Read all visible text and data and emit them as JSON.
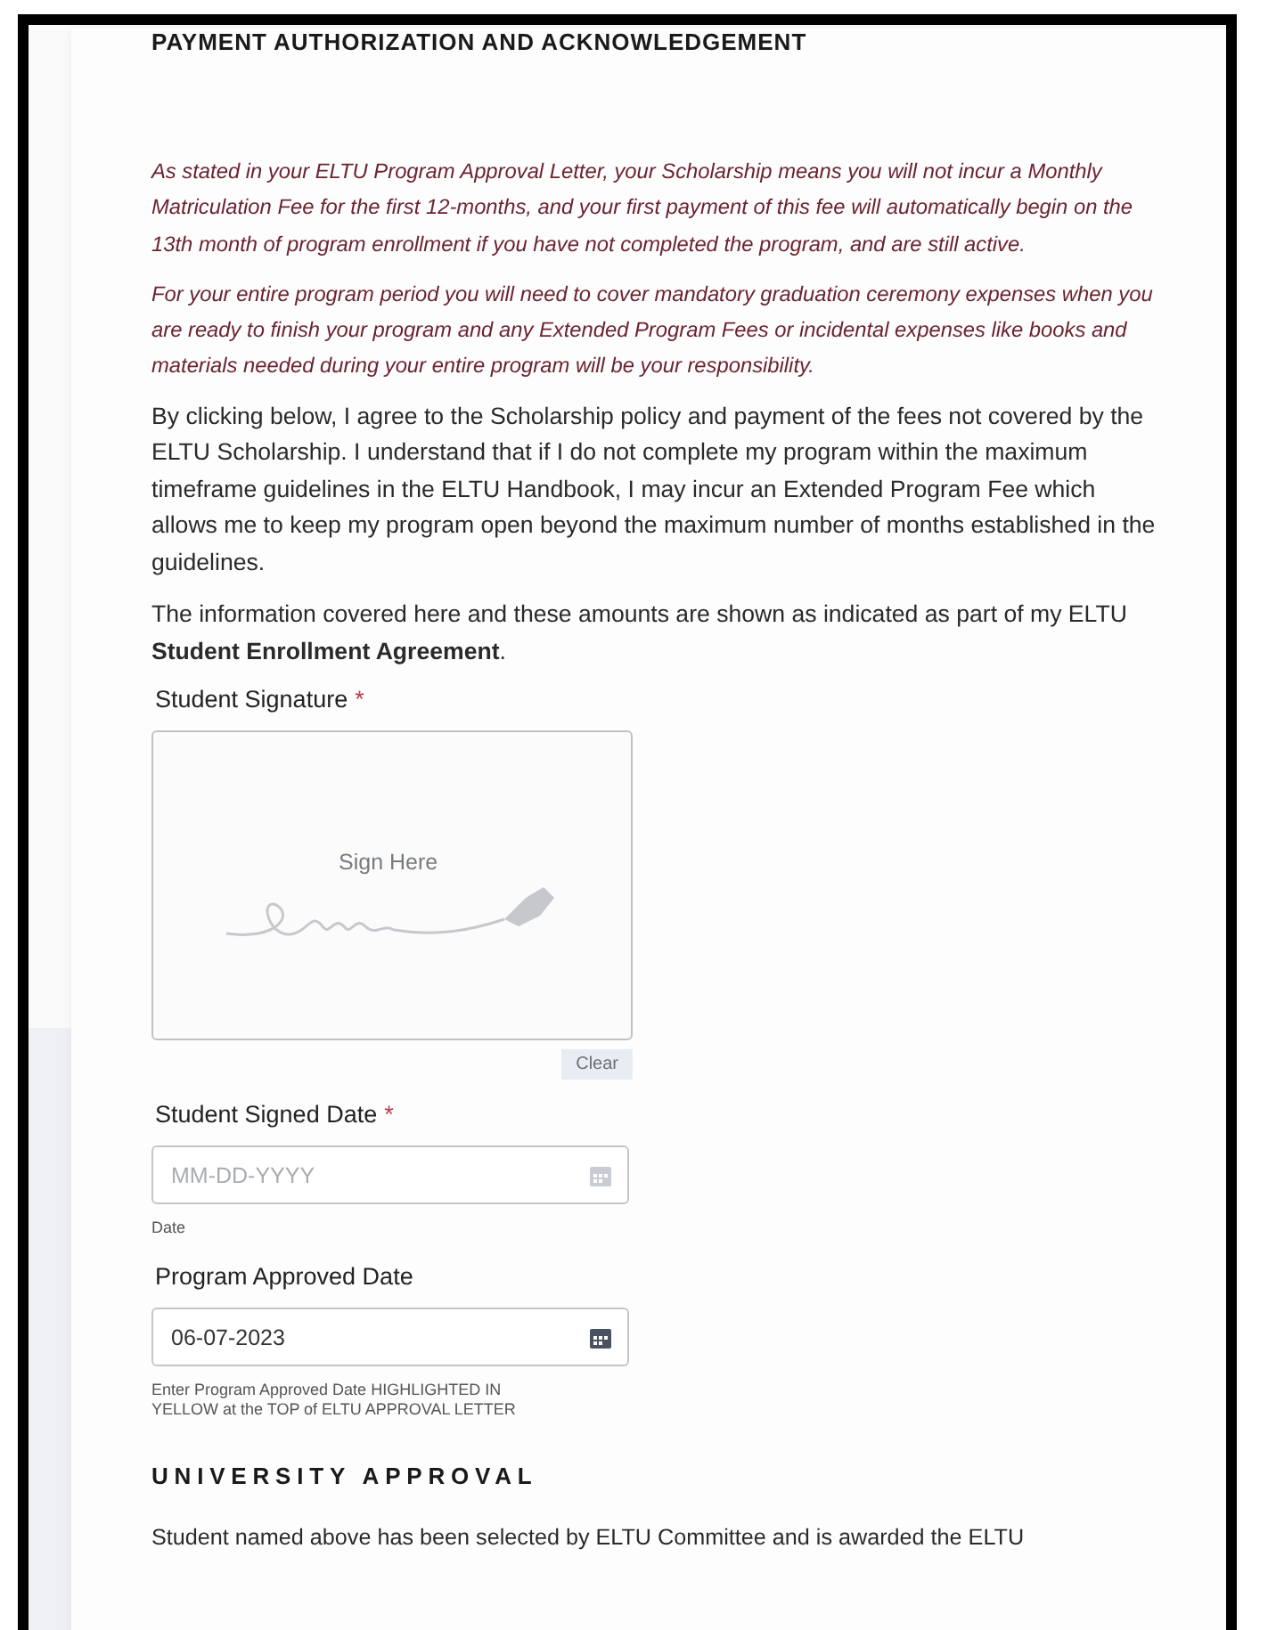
{
  "section_title": "PAYMENT AUTHORIZATION AND ACKNOWLEDGEMENT",
  "notices": [
    "As stated in your ELTU Program Approval Letter, your Scholarship means you will not incur a Monthly Matriculation Fee for the first 12-months, and your first payment of this fee will automatically begin on the 13th month of program enrollment if you have not completed the program, and are still active.",
    "For your entire program period you will need to cover mandatory graduation ceremony expenses when you are ready to finish your program and any Extended Program Fees or incidental expenses like books and materials needed during your entire program will be your responsibility."
  ],
  "paragraphs": [
    "By clicking below, I agree to the Scholarship policy and payment of the fees not covered by the ELTU Scholarship. I understand that if I do not complete my program within the maximum timeframe guidelines in the ELTU Handbook, I may incur an Extended Program Fee which allows me to keep my program open beyond the maximum number of months established in the guidelines.",
    "The information covered here and these amounts are shown as indicated as part of my ELTU **Student Enrollment Agreement**."
  ],
  "signature": {
    "label": "Student Signature",
    "required_mark": "*",
    "prompt": "Sign Here",
    "clear_button": "Clear"
  },
  "date_fields": [
    {
      "label": "Student Signed Date",
      "required_mark": "*",
      "placeholder": "MM-DD-YYYY",
      "help": "Date"
    },
    {
      "label": "Program Approved Date",
      "value": "06-07-2023",
      "help": "Enter Program Approved Date HIGHLIGHTED IN YELLOW at the TOP of ELTU APPROVAL LETTER"
    }
  ],
  "next_section": {
    "title": "UNIVERSITY APPROVAL",
    "text": "Student named above has been selected by ELTU Committee and is awarded the ELTU"
  }
}
